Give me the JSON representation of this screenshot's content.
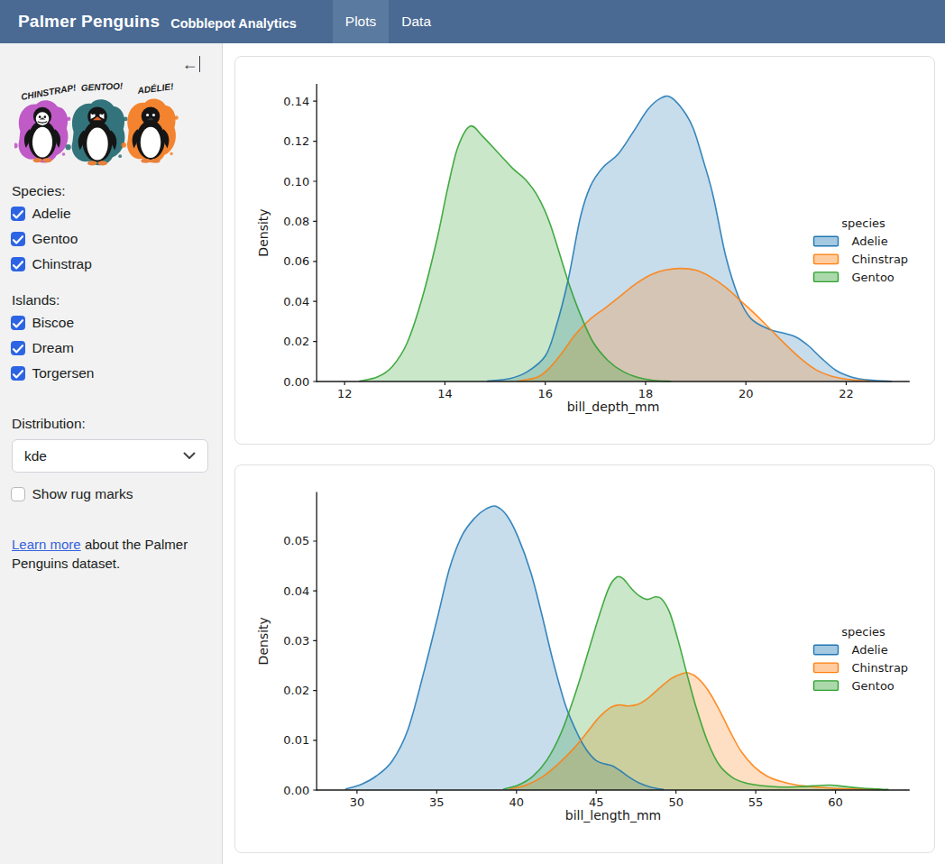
{
  "navbar": {
    "title": "Palmer Penguins",
    "subtitle": "Cobblepot Analytics",
    "tabs": [
      {
        "label": "Plots",
        "active": true
      },
      {
        "label": "Data",
        "active": false
      }
    ]
  },
  "sidebar": {
    "artwork_labels": [
      "CHINSTRAP!",
      "GENTOO!",
      "ADÉLIE!"
    ],
    "artwork_colors": [
      "#bb4fc4",
      "#256a73",
      "#f47b20"
    ],
    "species_label": "Species:",
    "species": [
      {
        "label": "Adelie",
        "checked": true
      },
      {
        "label": "Gentoo",
        "checked": true
      },
      {
        "label": "Chinstrap",
        "checked": true
      }
    ],
    "islands_label": "Islands:",
    "islands": [
      {
        "label": "Biscoe",
        "checked": true
      },
      {
        "label": "Dream",
        "checked": true
      },
      {
        "label": "Torgersen",
        "checked": true
      }
    ],
    "distribution_label": "Distribution:",
    "distribution_value": "kde",
    "rug_label": "Show rug marks",
    "rug_checked": false,
    "footer_link": "Learn more",
    "footer_rest": " about the Palmer Penguins dataset."
  },
  "chart_data": [
    {
      "type": "area",
      "kind": "kde",
      "xlabel": "bill_depth_mm",
      "ylabel": "Density",
      "xlim": [
        11.443,
        23.265
      ],
      "ylim": [
        0,
        0.14865
      ],
      "xticks": {
        "values": [
          12,
          14,
          16,
          18,
          20,
          22
        ],
        "labels": [
          "12",
          "14",
          "16",
          "18",
          "20",
          "22"
        ]
      },
      "yticks": {
        "values": [
          0,
          0.02,
          0.04,
          0.06,
          0.08,
          0.1,
          0.12,
          0.14
        ],
        "labels": [
          "0.00",
          "0.02",
          "0.04",
          "0.06",
          "0.08",
          "0.10",
          "0.12",
          "0.14"
        ]
      },
      "legend": {
        "title": "species",
        "entries": [
          "Adelie",
          "Chinstrap",
          "Gentoo"
        ]
      },
      "series": [
        {
          "name": "Adelie",
          "color": "#1f77b4",
          "points": [
            [
              14.85,
              0.0002
            ],
            [
              15.3,
              0.0015
            ],
            [
              15.65,
              0.005
            ],
            [
              16.0,
              0.0127
            ],
            [
              16.2,
              0.026
            ],
            [
              16.45,
              0.05
            ],
            [
              16.7,
              0.082
            ],
            [
              16.9,
              0.0975
            ],
            [
              17.15,
              0.107
            ],
            [
              17.45,
              0.1135
            ],
            [
              17.75,
              0.1245
            ],
            [
              18.05,
              0.136
            ],
            [
              18.3,
              0.1415
            ],
            [
              18.5,
              0.142
            ],
            [
              18.75,
              0.1355
            ],
            [
              18.95,
              0.1265
            ],
            [
              19.15,
              0.1105
            ],
            [
              19.35,
              0.0925
            ],
            [
              19.6,
              0.0625
            ],
            [
              19.85,
              0.0425
            ],
            [
              20.1,
              0.0315
            ],
            [
              20.45,
              0.0262
            ],
            [
              20.75,
              0.0242
            ],
            [
              21.0,
              0.0222
            ],
            [
              21.25,
              0.0178
            ],
            [
              21.5,
              0.0118
            ],
            [
              21.8,
              0.0055
            ],
            [
              22.1,
              0.0023
            ],
            [
              22.45,
              0.0007
            ],
            [
              22.9,
              0.0001
            ]
          ]
        },
        {
          "name": "Chinstrap",
          "color": "#ff7f0e",
          "points": [
            [
              15.45,
              0.0002
            ],
            [
              15.85,
              0.0022
            ],
            [
              16.1,
              0.0072
            ],
            [
              16.35,
              0.0148
            ],
            [
              16.6,
              0.0235
            ],
            [
              16.9,
              0.0312
            ],
            [
              17.2,
              0.0368
            ],
            [
              17.5,
              0.0427
            ],
            [
              17.8,
              0.0487
            ],
            [
              18.1,
              0.0533
            ],
            [
              18.4,
              0.0557
            ],
            [
              18.7,
              0.0565
            ],
            [
              19.0,
              0.0556
            ],
            [
              19.3,
              0.0522
            ],
            [
              19.6,
              0.047
            ],
            [
              19.9,
              0.0402
            ],
            [
              20.2,
              0.0333
            ],
            [
              20.5,
              0.0258
            ],
            [
              20.8,
              0.0183
            ],
            [
              21.1,
              0.0113
            ],
            [
              21.4,
              0.0058
            ],
            [
              21.7,
              0.0027
            ],
            [
              22.05,
              0.001
            ],
            [
              22.45,
              0.0002
            ]
          ]
        },
        {
          "name": "Gentoo",
          "color": "#2ca02c",
          "points": [
            [
              12.3,
              0.0002
            ],
            [
              12.65,
              0.0022
            ],
            [
              12.95,
              0.0075
            ],
            [
              13.25,
              0.0195
            ],
            [
              13.55,
              0.042
            ],
            [
              13.85,
              0.072
            ],
            [
              14.05,
              0.096
            ],
            [
              14.25,
              0.1165
            ],
            [
              14.5,
              0.1275
            ],
            [
              14.75,
              0.1225
            ],
            [
              15.05,
              0.1145
            ],
            [
              15.35,
              0.1065
            ],
            [
              15.6,
              0.101
            ],
            [
              15.85,
              0.0925
            ],
            [
              16.1,
              0.0785
            ],
            [
              16.45,
              0.0505
            ],
            [
              16.7,
              0.0335
            ],
            [
              16.95,
              0.0198
            ],
            [
              17.25,
              0.0105
            ],
            [
              17.55,
              0.005
            ],
            [
              17.85,
              0.002
            ],
            [
              18.15,
              0.0006
            ],
            [
              18.5,
              0.0001
            ]
          ]
        }
      ]
    },
    {
      "type": "area",
      "kind": "kde",
      "xlabel": "bill_length_mm",
      "ylabel": "Density",
      "xlim": [
        27.473,
        64.65
      ],
      "ylim": [
        0,
        0.05987
      ],
      "xticks": {
        "values": [
          30,
          35,
          40,
          45,
          50,
          55,
          60
        ],
        "labels": [
          "30",
          "35",
          "40",
          "45",
          "50",
          "55",
          "60"
        ]
      },
      "yticks": {
        "values": [
          0,
          0.01,
          0.02,
          0.03,
          0.04,
          0.05
        ],
        "labels": [
          "0.00",
          "0.01",
          "0.02",
          "0.03",
          "0.04",
          "0.05"
        ]
      },
      "legend": {
        "title": "species",
        "entries": [
          "Adelie",
          "Chinstrap",
          "Gentoo"
        ]
      },
      "series": [
        {
          "name": "Adelie",
          "color": "#1f77b4",
          "points": [
            [
              29.3,
              0.0002
            ],
            [
              30.3,
              0.0012
            ],
            [
              31.2,
              0.0028
            ],
            [
              32.2,
              0.0058
            ],
            [
              33.2,
              0.0122
            ],
            [
              34.2,
              0.0238
            ],
            [
              35.0,
              0.034
            ],
            [
              35.8,
              0.0445
            ],
            [
              36.6,
              0.0512
            ],
            [
              37.4,
              0.0547
            ],
            [
              38.1,
              0.0565
            ],
            [
              38.7,
              0.057
            ],
            [
              39.4,
              0.0551
            ],
            [
              40.1,
              0.0508
            ],
            [
              40.9,
              0.0437
            ],
            [
              41.6,
              0.0351
            ],
            [
              42.3,
              0.0258
            ],
            [
              43.1,
              0.0168
            ],
            [
              43.9,
              0.0108
            ],
            [
              44.4,
              0.008
            ],
            [
              45.0,
              0.0059
            ],
            [
              45.6,
              0.0052
            ],
            [
              46.0,
              0.0049
            ],
            [
              46.5,
              0.0039
            ],
            [
              47.1,
              0.0025
            ],
            [
              47.7,
              0.0014
            ],
            [
              48.4,
              0.0006
            ],
            [
              49.2,
              0.0001
            ]
          ]
        },
        {
          "name": "Chinstrap",
          "color": "#ff7f0e",
          "points": [
            [
              39.6,
              0.0002
            ],
            [
              40.6,
              0.001
            ],
            [
              41.6,
              0.0026
            ],
            [
              42.6,
              0.0052
            ],
            [
              43.6,
              0.0084
            ],
            [
              44.5,
              0.0119
            ],
            [
              45.2,
              0.0147
            ],
            [
              45.9,
              0.0166
            ],
            [
              46.4,
              0.0171
            ],
            [
              47.0,
              0.0169
            ],
            [
              47.6,
              0.0172
            ],
            [
              48.3,
              0.0186
            ],
            [
              49.0,
              0.0206
            ],
            [
              49.7,
              0.0224
            ],
            [
              50.3,
              0.0233
            ],
            [
              50.8,
              0.0235
            ],
            [
              51.4,
              0.0224
            ],
            [
              52.0,
              0.0201
            ],
            [
              52.7,
              0.0162
            ],
            [
              53.4,
              0.0117
            ],
            [
              54.1,
              0.0077
            ],
            [
              54.9,
              0.0047
            ],
            [
              55.7,
              0.0028
            ],
            [
              56.6,
              0.0017
            ],
            [
              57.6,
              0.001
            ],
            [
              58.8,
              0.0006
            ],
            [
              60.2,
              0.0003
            ],
            [
              61.5,
              0.0002
            ],
            [
              62.8,
              0.0001
            ]
          ]
        },
        {
          "name": "Gentoo",
          "color": "#2ca02c",
          "points": [
            [
              39.2,
              0.0002
            ],
            [
              40.1,
              0.001
            ],
            [
              41.0,
              0.0027
            ],
            [
              41.9,
              0.006
            ],
            [
              42.8,
              0.0115
            ],
            [
              43.7,
              0.0195
            ],
            [
              44.5,
              0.0278
            ],
            [
              45.2,
              0.0352
            ],
            [
              45.8,
              0.0407
            ],
            [
              46.3,
              0.0428
            ],
            [
              46.7,
              0.0424
            ],
            [
              47.2,
              0.0405
            ],
            [
              47.7,
              0.039
            ],
            [
              48.2,
              0.0383
            ],
            [
              48.7,
              0.0388
            ],
            [
              49.1,
              0.0384
            ],
            [
              49.6,
              0.0357
            ],
            [
              50.1,
              0.0305
            ],
            [
              50.7,
              0.0232
            ],
            [
              51.3,
              0.0162
            ],
            [
              52.0,
              0.0096
            ],
            [
              52.7,
              0.0051
            ],
            [
              53.5,
              0.0026
            ],
            [
              54.3,
              0.0015
            ],
            [
              55.3,
              0.0009
            ],
            [
              56.6,
              0.0006
            ],
            [
              57.9,
              0.0007
            ],
            [
              58.9,
              0.0009
            ],
            [
              59.7,
              0.001
            ],
            [
              60.6,
              0.0007
            ],
            [
              61.6,
              0.0004
            ],
            [
              62.6,
              0.0002
            ],
            [
              63.3,
              0.0001
            ]
          ]
        }
      ]
    }
  ]
}
